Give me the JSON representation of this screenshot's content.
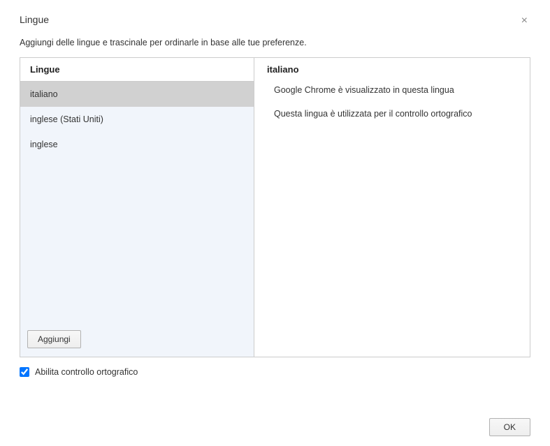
{
  "dialog": {
    "title": "Lingue",
    "subtitle": "Aggiungi delle lingue e trascinale per ordinarle in base alle tue preferenze."
  },
  "left": {
    "header": "Lingue",
    "items": [
      {
        "label": "italiano",
        "selected": true
      },
      {
        "label": "inglese (Stati Uniti)",
        "selected": false
      },
      {
        "label": "inglese",
        "selected": false
      }
    ],
    "add_button": "Aggiungi"
  },
  "right": {
    "header": "italiano",
    "line1": "Google Chrome è visualizzato in questa lingua",
    "line2": "Questa lingua è utilizzata per il controllo ortografico"
  },
  "checkbox": {
    "label": "Abilita controllo ortografico",
    "checked": true
  },
  "footer": {
    "ok": "OK"
  }
}
